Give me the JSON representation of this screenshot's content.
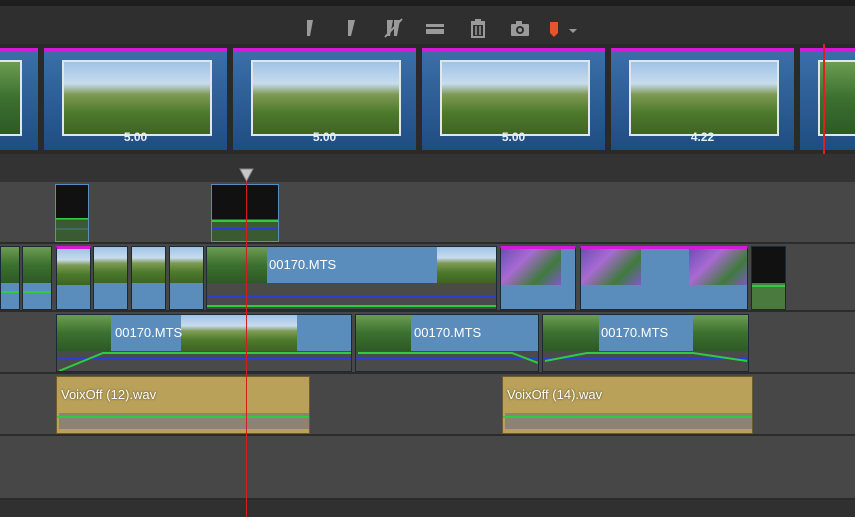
{
  "toolbar": {
    "icons": [
      "marker-left-icon",
      "marker-right-icon",
      "split-off-icon",
      "insert-gap-icon",
      "trash-icon",
      "camera-icon",
      "marker-flag-icon"
    ],
    "accent": "#e8542a"
  },
  "storyboard": {
    "cards": [
      {
        "duration": ""
      },
      {
        "duration": "5.00"
      },
      {
        "duration": "5.00"
      },
      {
        "duration": "5.00"
      },
      {
        "duration": "4.22"
      },
      {
        "duration": ""
      }
    ]
  },
  "timeline": {
    "video_track_1": {
      "clips": [
        {
          "label": "00170.MTS"
        }
      ]
    },
    "video_track_2": {
      "clips": [
        {
          "label": "00170.MTS"
        },
        {
          "label": "00170.MTS"
        },
        {
          "label": "00170.MTS"
        }
      ]
    },
    "audio_track": {
      "clips": [
        {
          "label": "VoixOff (12).wav"
        },
        {
          "label": "VoixOff (14).wav"
        }
      ]
    }
  }
}
